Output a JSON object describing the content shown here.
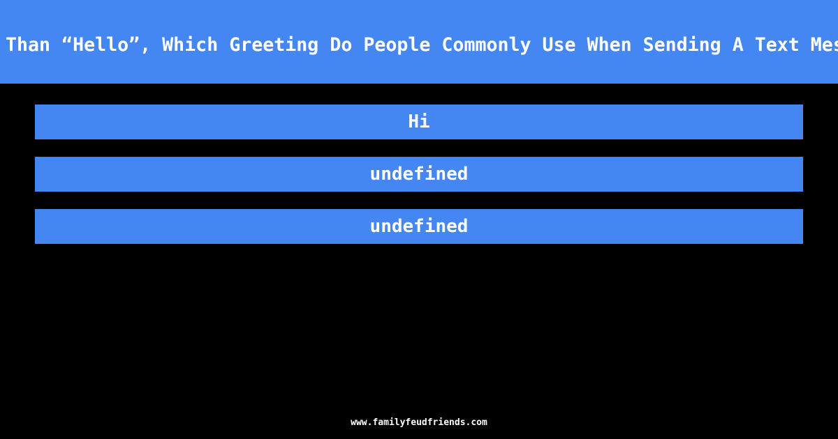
{
  "question": "Than “Hello”, Which Greeting Do People Commonly Use When Sending A Text Mes",
  "answers": [
    {
      "label": "Hi"
    },
    {
      "label": "undefined"
    },
    {
      "label": "undefined"
    }
  ],
  "footer": "www.familyfeudfriends.com",
  "colors": {
    "accent": "#4487f2",
    "background": "#000000",
    "text": "#ffffff"
  }
}
